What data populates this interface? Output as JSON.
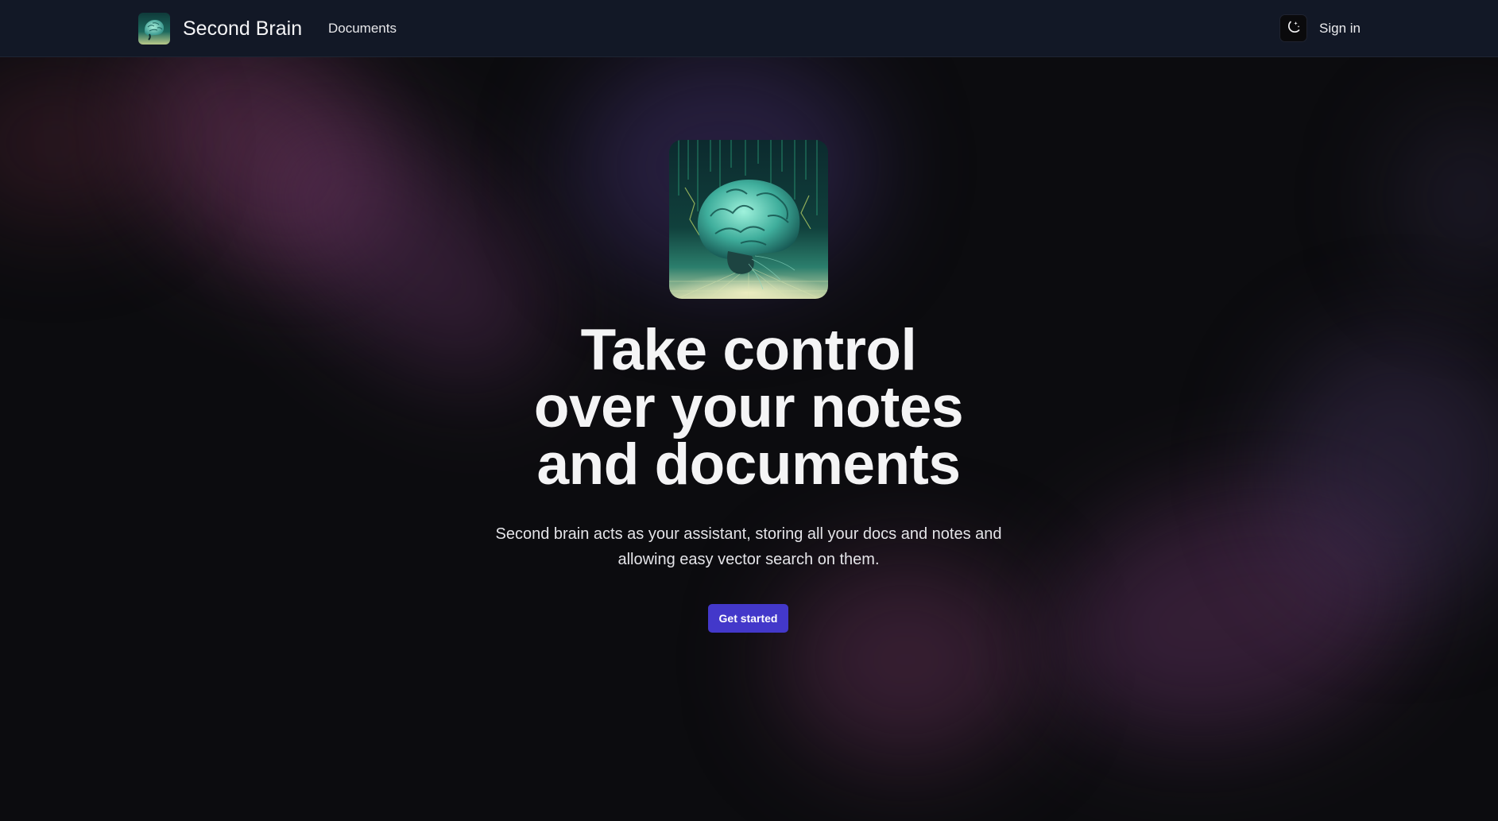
{
  "colors": {
    "background": "#0c0c0f",
    "navbar": "#121826",
    "accent": "#4338ca",
    "text": "#f4f4f5"
  },
  "navbar": {
    "logo_icon": "brain-logo-icon",
    "brand": "Second Brain",
    "links": [
      {
        "label": "Documents"
      }
    ],
    "theme_toggle_icon": "moon-sparkle-icon",
    "signin_label": "Sign in"
  },
  "hero": {
    "image_icon": "circuit-brain-image",
    "headline_lines": [
      "Take control",
      "over your notes",
      "and documents"
    ],
    "subtitle_lines": [
      "Second brain acts as your assistant, storing all your docs and notes and",
      "allowing easy vector search on them."
    ],
    "cta_label": "Get started"
  }
}
